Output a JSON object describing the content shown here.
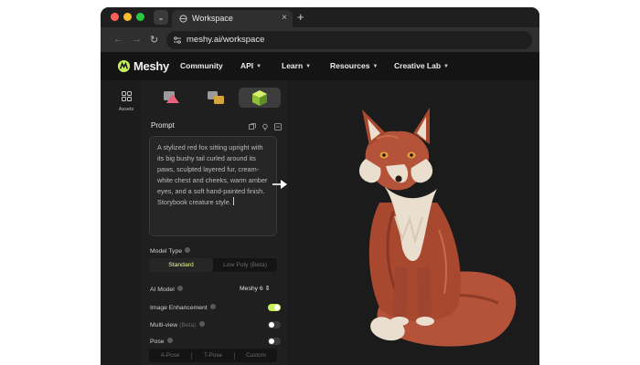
{
  "browser": {
    "tab_title": "Workspace",
    "url": "meshy.ai/workspace",
    "traffic_colors": [
      "#ff5f57",
      "#febc2e",
      "#28c840"
    ]
  },
  "app": {
    "brand": "Meshy",
    "nav": [
      {
        "label": "Community",
        "dropdown": false
      },
      {
        "label": "API",
        "dropdown": true
      },
      {
        "label": "Learn",
        "dropdown": true
      },
      {
        "label": "Resources",
        "dropdown": true
      },
      {
        "label": "Creative Lab",
        "dropdown": true
      }
    ]
  },
  "rail": {
    "assets_label": "Assets"
  },
  "panel": {
    "prompt_label": "Prompt",
    "prompt_text": "A stylized red fox sitting upright with its big bushy tail curled around its paws, sculpted layered fur, cream-white chest and cheeks, warm amber eyes, and a soft hand-painted finish. Storybook creature style.",
    "model_type_label": "Model Type",
    "model_type_options": [
      "Standard",
      "Low Poly (Beta)"
    ],
    "model_type_selected": "Standard",
    "ai_model_label": "AI Model",
    "ai_model_value": "Meshy 6",
    "image_enhancement_label": "Image Enhancement",
    "image_enhancement_on": true,
    "multiview_label": "Multi-view",
    "multiview_beta": "(Beta)",
    "multiview_on": false,
    "pose_label": "Pose",
    "pose_on": false,
    "pose_options": [
      "A-Pose",
      "T-Pose",
      "Custom"
    ]
  },
  "colors": {
    "accent_green": "#c8f05a",
    "fox_fur": "#b5533a",
    "fox_cream": "#eadfcf"
  }
}
